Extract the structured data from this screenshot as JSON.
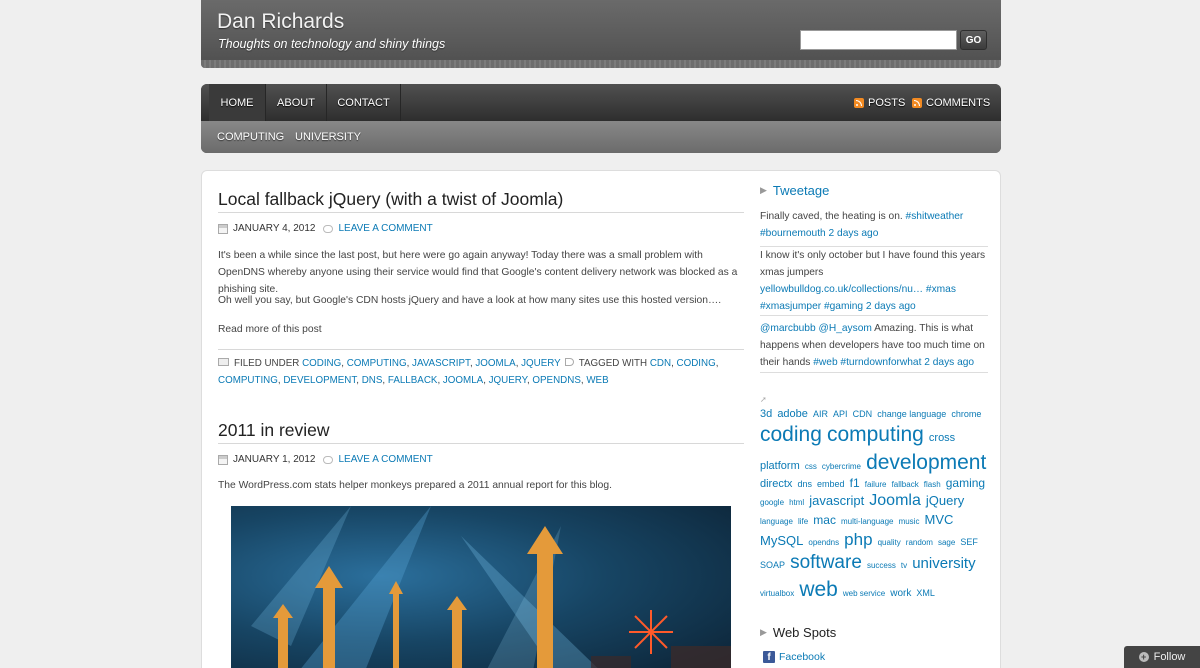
{
  "header": {
    "title": "Dan Richards",
    "description": "Thoughts on technology and shiny things",
    "search_go": "GO"
  },
  "nav": {
    "items": [
      "HOME",
      "ABOUT",
      "CONTACT"
    ],
    "feeds": [
      "POSTS",
      "COMMENTS"
    ],
    "categories": [
      "COMPUTING",
      "UNIVERSITY"
    ]
  },
  "posts": [
    {
      "title": "Local fallback jQuery (with a twist of Joomla)",
      "date": "JANUARY 4, 2012",
      "comment": "LEAVE A COMMENT",
      "p1": "It's been a while since the last post, but here were go again anyway! Today there was a small problem with OpenDNS whereby anyone using their service would find that Google's content delivery network was blocked as a phishing site.",
      "p2": "Oh well you say, but Google's CDN hosts jQuery and have a look at how many sites use this hosted version….",
      "read_more": "Read more of this post",
      "filed_label": "FILED UNDER",
      "filed": [
        "CODING",
        "COMPUTING",
        "JAVASCRIPT",
        "JOOMLA",
        "JQUERY"
      ],
      "tagged_label": "TAGGED WITH",
      "tags": [
        "CDN",
        "CODING",
        "COMPUTING",
        "DEVELOPMENT",
        "DNS",
        "FALLBACK",
        "JOOMLA",
        "JQUERY",
        "OPENDNS",
        "WEB"
      ]
    },
    {
      "title": "2011 in review",
      "date": "JANUARY 1, 2012",
      "comment": "LEAVE A COMMENT",
      "p1": "The WordPress.com stats helper monkeys prepared a 2011 annual report for this blog."
    }
  ],
  "sidebar": {
    "tweetage_title": "Tweetage",
    "tweets": [
      {
        "text": "Finally caved, the heating is on. ",
        "links": "#shitweather #bournemouth 2 days ago"
      },
      {
        "text": "I know it's only october but I have found this years xmas jumpers ",
        "links": "yellowbulldog.co.uk/collections/nu… #xmas #xmasjumper #gaming 2 days ago"
      },
      {
        "text_parts": [
          "@marcbubb",
          " ",
          "@H_aysom",
          " Amazing. This is what happens when developers have too much time on their hands "
        ],
        "links": "#web #turndownforwhat 2 days ago"
      }
    ],
    "tags": [
      {
        "t": "3d",
        "s": 11
      },
      {
        "t": "adobe",
        "s": 11
      },
      {
        "t": "AIR",
        "s": 9
      },
      {
        "t": "API",
        "s": 9
      },
      {
        "t": "CDN",
        "s": 9
      },
      {
        "t": "change language",
        "s": 9
      },
      {
        "t": "chrome",
        "s": 9
      },
      {
        "t": "coding",
        "s": 21
      },
      {
        "t": "computing",
        "s": 21
      },
      {
        "t": "cross platform",
        "s": 11
      },
      {
        "t": "css",
        "s": 8
      },
      {
        "t": "cybercrime",
        "s": 8
      },
      {
        "t": "development",
        "s": 21
      },
      {
        "t": "directx",
        "s": 11
      },
      {
        "t": "dns",
        "s": 9
      },
      {
        "t": "embed",
        "s": 9
      },
      {
        "t": "f1",
        "s": 12
      },
      {
        "t": "failure",
        "s": 8
      },
      {
        "t": "fallback",
        "s": 8
      },
      {
        "t": "flash",
        "s": 8
      },
      {
        "t": "gaming",
        "s": 12
      },
      {
        "t": "google",
        "s": 8
      },
      {
        "t": "html",
        "s": 8
      },
      {
        "t": "javascript",
        "s": 13
      },
      {
        "t": "Joomla",
        "s": 16
      },
      {
        "t": "jQuery",
        "s": 13
      },
      {
        "t": "language",
        "s": 8
      },
      {
        "t": "life",
        "s": 8
      },
      {
        "t": "mac",
        "s": 12
      },
      {
        "t": "multi-language",
        "s": 8
      },
      {
        "t": "music",
        "s": 8
      },
      {
        "t": "MVC",
        "s": 13
      },
      {
        "t": "MySQL",
        "s": 13
      },
      {
        "t": "opendns",
        "s": 8
      },
      {
        "t": "php",
        "s": 17
      },
      {
        "t": "quality",
        "s": 8
      },
      {
        "t": "random",
        "s": 8
      },
      {
        "t": "sage",
        "s": 8
      },
      {
        "t": "SEF",
        "s": 9
      },
      {
        "t": "SOAP",
        "s": 9
      },
      {
        "t": "software",
        "s": 19
      },
      {
        "t": "success",
        "s": 8
      },
      {
        "t": "tv",
        "s": 8
      },
      {
        "t": "university",
        "s": 15
      },
      {
        "t": "virtualbox",
        "s": 8
      },
      {
        "t": "web",
        "s": 21
      },
      {
        "t": "web service",
        "s": 8
      },
      {
        "t": "work",
        "s": 10
      },
      {
        "t": "XML",
        "s": 9
      }
    ],
    "webspots_title": "Web Spots",
    "facebook": "Facebook"
  },
  "follow": "Follow",
  "colors": {
    "link": "#0b7ab5",
    "feed": "#f28a22"
  }
}
